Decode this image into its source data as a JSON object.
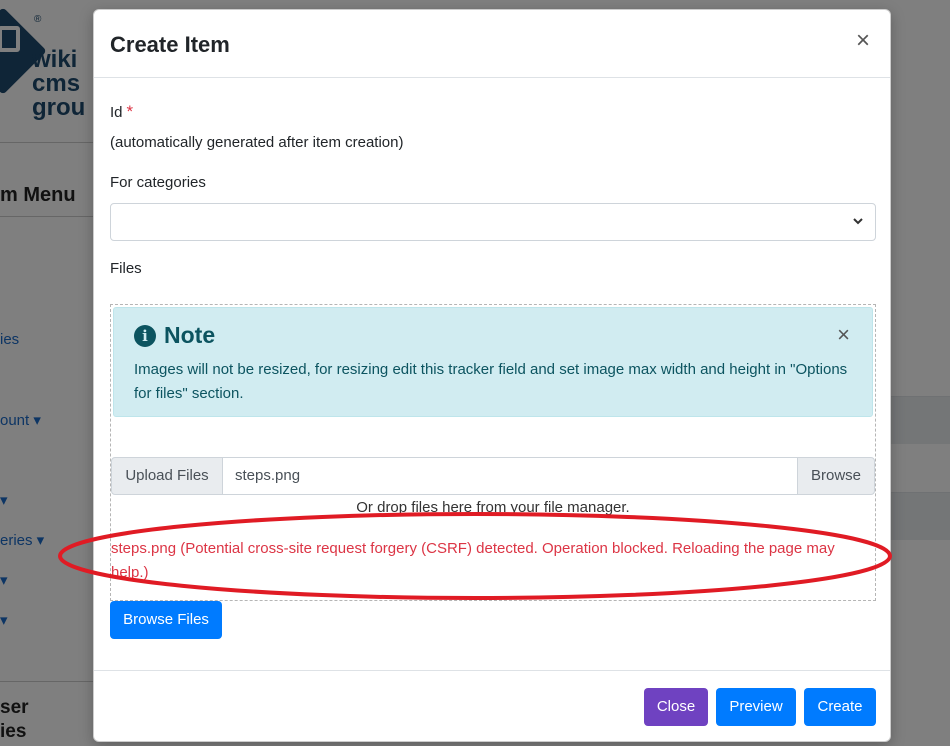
{
  "background": {
    "logo": {
      "registered": "®",
      "line1": "wiki",
      "line2": "cms",
      "line3": "grou"
    },
    "menu_title": "m Menu",
    "links": [
      "ies",
      "ount ▾",
      "▾",
      "eries ▾",
      "▾",
      "▾"
    ],
    "bottom_text": {
      "line1": "ser",
      "line2": "ies"
    }
  },
  "modal": {
    "title": "Create Item",
    "close_glyph": "×",
    "id_label": "Id",
    "required_marker": "*",
    "id_help": "(automatically generated after item creation)",
    "categories_label": "For categories",
    "categories_value": "",
    "files_label": "Files",
    "note": {
      "icon_glyph": "i",
      "title": "Note",
      "close_glyph": "×",
      "text": "Images will not be resized, for resizing edit this tracker field and set image max width and height in \"Options for files\" section."
    },
    "upload": {
      "label": "Upload Files",
      "file_name": "steps.png",
      "browse": "Browse"
    },
    "drop_hint": "Or drop files here from your file manager.",
    "error": "steps.png (Potential cross-site request forgery (CSRF) detected. Operation blocked. Reloading the page may help.)",
    "browse_files": "Browse Files",
    "footer": {
      "close": "Close",
      "preview": "Preview",
      "create": "Create"
    }
  },
  "colors": {
    "primary": "#007bff",
    "purple": "#6f42c1",
    "danger": "#dc3545",
    "info_bg": "#d1ecf1",
    "info_text": "#0c5460",
    "annotation": "#e01b24"
  }
}
